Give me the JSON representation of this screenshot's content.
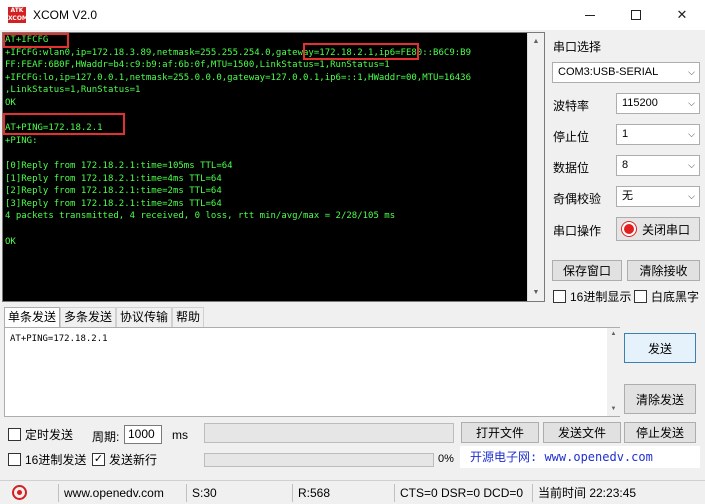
{
  "window": {
    "title": "XCOM V2.0",
    "logo_text": "ATK XCOM",
    "minimize": "—",
    "maximize": "□",
    "close": "✕"
  },
  "terminal": {
    "lines": [
      "AT+IFCFG",
      "+IFCFG:wlan0,ip=172.18.3.89,netmask=255.255.254.0,gateway=172.18.2.1,ip6=FE80::B6C9:B9",
      "FF:FEAF:6B0F,HWaddr=b4:c9:b9:af:6b:0f,MTU=1500,LinkStatus=1,RunStatus=1",
      "+IFCFG:lo,ip=127.0.0.1,netmask=255.0.0.0,gateway=127.0.0.1,ip6=::1,HWaddr=00,MTU=16436",
      ",LinkStatus=1,RunStatus=1",
      "OK",
      "",
      "AT+PING=172.18.2.1",
      "+PING:",
      "",
      "[0]Reply from 172.18.2.1:time=105ms TTL=64",
      "[1]Reply from 172.18.2.1:time=4ms TTL=64",
      "[2]Reply from 172.18.2.1:time=2ms TTL=64",
      "[3]Reply from 172.18.2.1:time=2ms TTL=64",
      "4 packets transmitted, 4 received, 0 loss, rtt min/avg/max = 2/28/105 ms",
      "",
      "OK"
    ],
    "text_color": "#4cff4c",
    "highlight_color": "#e53030"
  },
  "settings": {
    "section_title": "串口选择",
    "port": "COM3:USB-SERIAL",
    "baud_label": "波特率",
    "baud": "115200",
    "stopbit_label": "停止位",
    "stopbit": "1",
    "databit_label": "数据位",
    "databit": "8",
    "parity_label": "奇偶校验",
    "parity": "无",
    "operation_label": "串口操作",
    "close_port": "关闭串口",
    "save_window": "保存窗口",
    "clear_receive": "清除接收",
    "hex_display": "16进制显示",
    "white_bg": "白底黑字"
  },
  "tabs": [
    {
      "label": "单条发送",
      "active": true
    },
    {
      "label": "多条发送",
      "active": false
    },
    {
      "label": "协议传输",
      "active": false
    },
    {
      "label": "帮助",
      "active": false
    }
  ],
  "send": {
    "text": "AT+PING=172.18.2.1",
    "send_button": "发送",
    "clear_send": "清除发送",
    "timed_send": "定时发送",
    "period_label": "周期:",
    "period_value": "1000",
    "period_unit": "ms",
    "open_file": "打开文件",
    "send_file": "发送文件",
    "stop_send": "停止发送",
    "hex_send": "16进制发送",
    "send_newline": "发送新行",
    "send_newline_checked": true,
    "progress_label": "0%",
    "promo": "开源电子网: www.openedv.com"
  },
  "statusbar": {
    "url": "www.openedv.com",
    "sent": "S:30",
    "received": "R:568",
    "signals": "CTS=0 DSR=0 DCD=0",
    "time": "当前时间 22:23:45"
  }
}
